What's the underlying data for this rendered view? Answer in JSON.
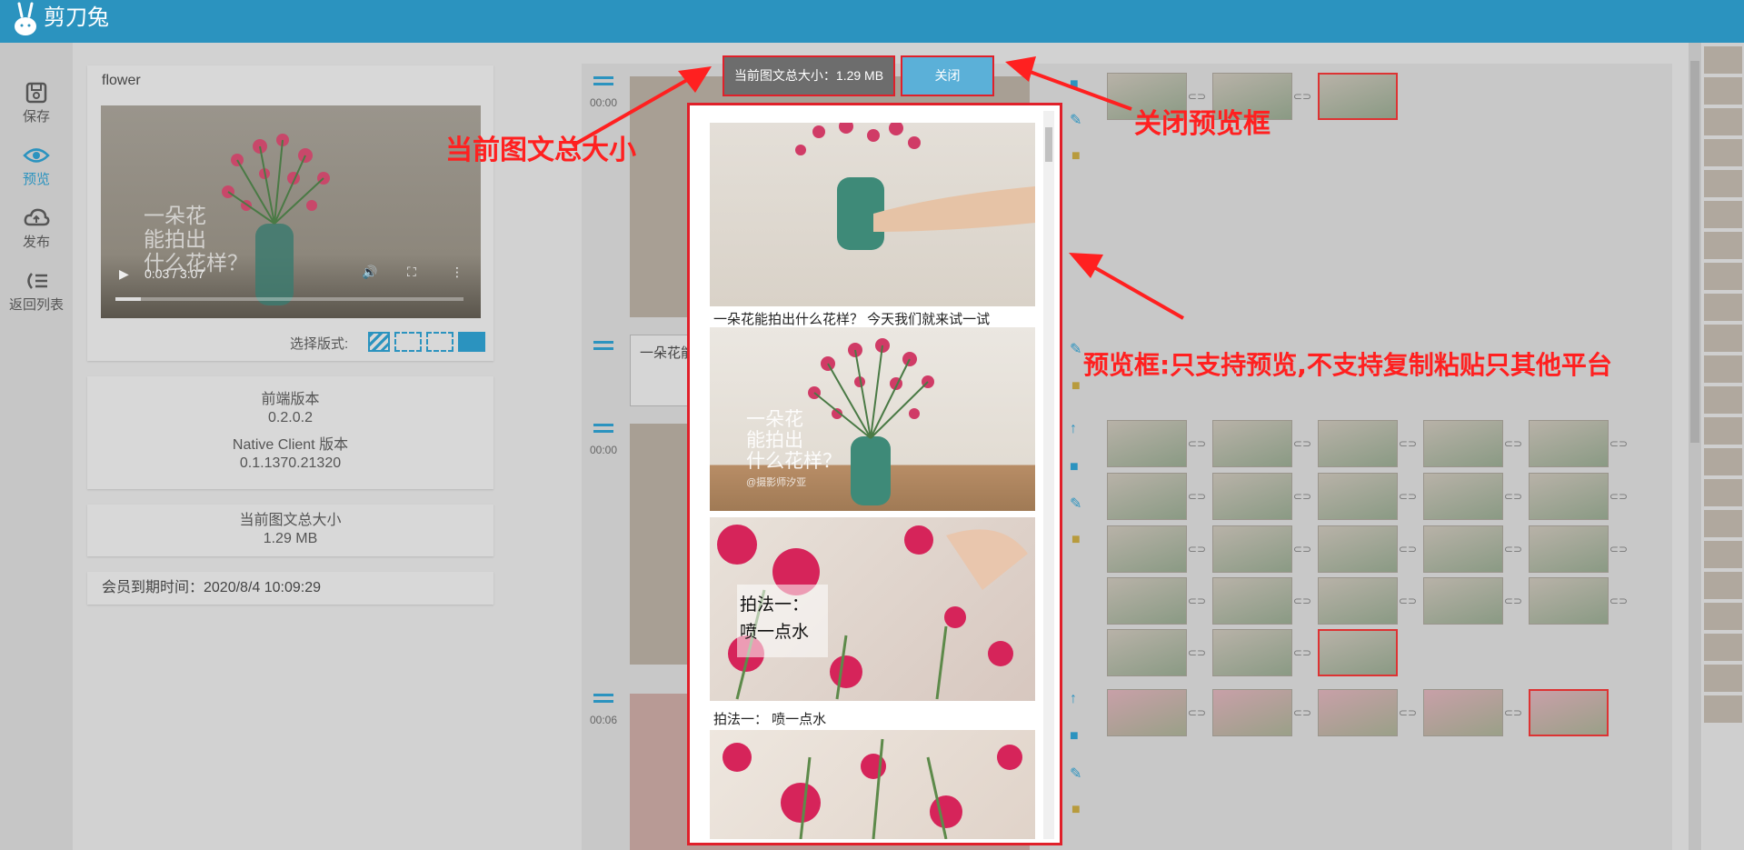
{
  "app": {
    "title": "剪刀兔"
  },
  "nav": [
    {
      "label": "保存",
      "icon": "save-icon"
    },
    {
      "label": "预览",
      "icon": "eye-icon"
    },
    {
      "label": "发布",
      "icon": "cloud-upload-icon"
    },
    {
      "label": "返回列表",
      "icon": "list-back-icon"
    }
  ],
  "media": {
    "title": "flower",
    "time": "0:03 / 3:07",
    "overlay_lines": [
      "一朵花",
      "能拍出",
      "什么花样？"
    ],
    "layout_label": "选择版式:"
  },
  "version": {
    "frontend_label": "前端版本",
    "frontend_value": "0.2.0.2",
    "native_label": "Native Client 版本",
    "native_value": "0.1.1370.21320"
  },
  "size": {
    "label": "当前图文总大小",
    "value": "1.29 MB"
  },
  "member": {
    "text": "会员到期时间：2020/8/4 10:09:29"
  },
  "segments": [
    {
      "time": "00:00"
    },
    {
      "time": "00:00"
    },
    {
      "time": "00:06"
    }
  ],
  "text_block": {
    "value": "一朵花能"
  },
  "preview": {
    "size_text": "当前图文总大小：1.29 MB",
    "close_label": "关闭",
    "caption1": "一朵花能拍出什么花样？  今天我们就来试一试",
    "caption2": "拍法一：  喷一点水",
    "overlay_a": [
      "一朵花",
      "能拍出",
      "什么花样？"
    ],
    "watermark": "@摄影师汐亚",
    "overlay_b": [
      "拍法一：",
      "喷一点水"
    ]
  },
  "annotations": {
    "size": "当前图文总大小",
    "close": "关闭预览框",
    "preview": "预览框:只支持预览,不支持复制粘贴只其他平台"
  },
  "colors": {
    "brand": "#2b93bf",
    "annotation": "#ff2020"
  }
}
